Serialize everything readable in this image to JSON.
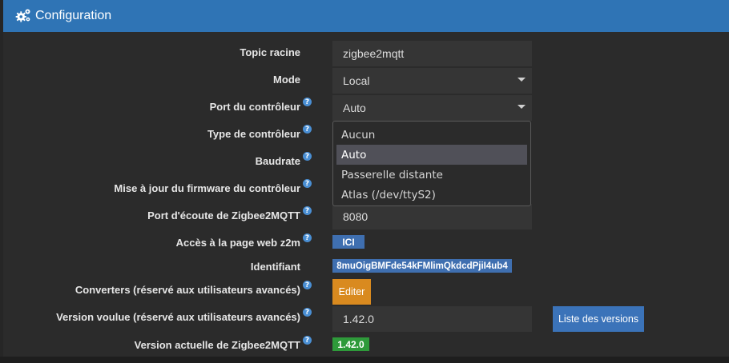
{
  "header": {
    "title": "Configuration",
    "icon": "gears-icon"
  },
  "form": {
    "topic_label": "Topic racine",
    "topic_value": "zigbee2mqtt",
    "mode_label": "Mode",
    "mode_value": "Local",
    "port_label": "Port du contrôleur",
    "port_value": "Auto",
    "port_options": [
      "Aucun",
      "Auto",
      "Passerelle distante",
      "Atlas (/dev/ttyS2)"
    ],
    "type_label": "Type de contrôleur",
    "baudrate_label": "Baudrate",
    "firmware_label": "Mise à jour du firmware du contrôleur",
    "listen_port_label": "Port d'écoute de Zigbee2MQTT",
    "listen_port_value": "8080",
    "web_access_label": "Accès à la page web z2m",
    "web_access_button": "ICI",
    "identifier_label": "Identifiant",
    "identifier_value": "8muOigBMFde54kFMlimQkdcdPjiI4ub4",
    "converters_label": "Converters (réservé aux utilisateurs avancés)",
    "converters_button": "Editer",
    "wanted_version_label": "Version voulue (réservé aux utilisateurs avancés)",
    "wanted_version_value": "1.42.0",
    "versions_list_button": "Liste des versions",
    "current_version_label": "Version actuelle de Zigbee2MQTT",
    "current_version_value": "1.42.0",
    "help_glyph": "?"
  },
  "colors": {
    "header": "#2f74b5",
    "badge_blue": "#3f6fb0",
    "button_orange": "#d98a1f",
    "button_blue": "#3b73b9",
    "badge_green": "#2e9a3a"
  }
}
